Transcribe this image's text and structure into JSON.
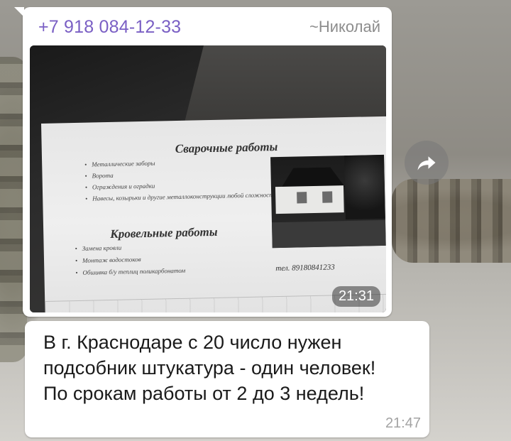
{
  "message_photo": {
    "sender_phone": "+7 918 084-12-33",
    "sender_name": "~Николай",
    "time": "21:31",
    "flyer": {
      "title_1": "Сварочные работы",
      "items_1": [
        "Металлические заборы",
        "Ворота",
        "Ограждения и оградки",
        "Навесы, козырьки и другие металлоконструкции любой сложности"
      ],
      "title_2": "Кровельные работы",
      "items_2": [
        "Замена кровли",
        "Монтаж водостоков",
        "Обшивка б/у теплиц поликарбонатом"
      ],
      "phone": "тел. 89180841233"
    }
  },
  "message_text": {
    "text": "В г. Краснодаре с 20 число нужен подсобник штукатура - один человек! По срокам работы от 2 до 3 недель!",
    "time": "21:47"
  },
  "icons": {
    "forward": "forward-arrow-icon"
  },
  "colors": {
    "sender_name_accent": "#7a5fc4",
    "bubble": "#ffffff"
  }
}
